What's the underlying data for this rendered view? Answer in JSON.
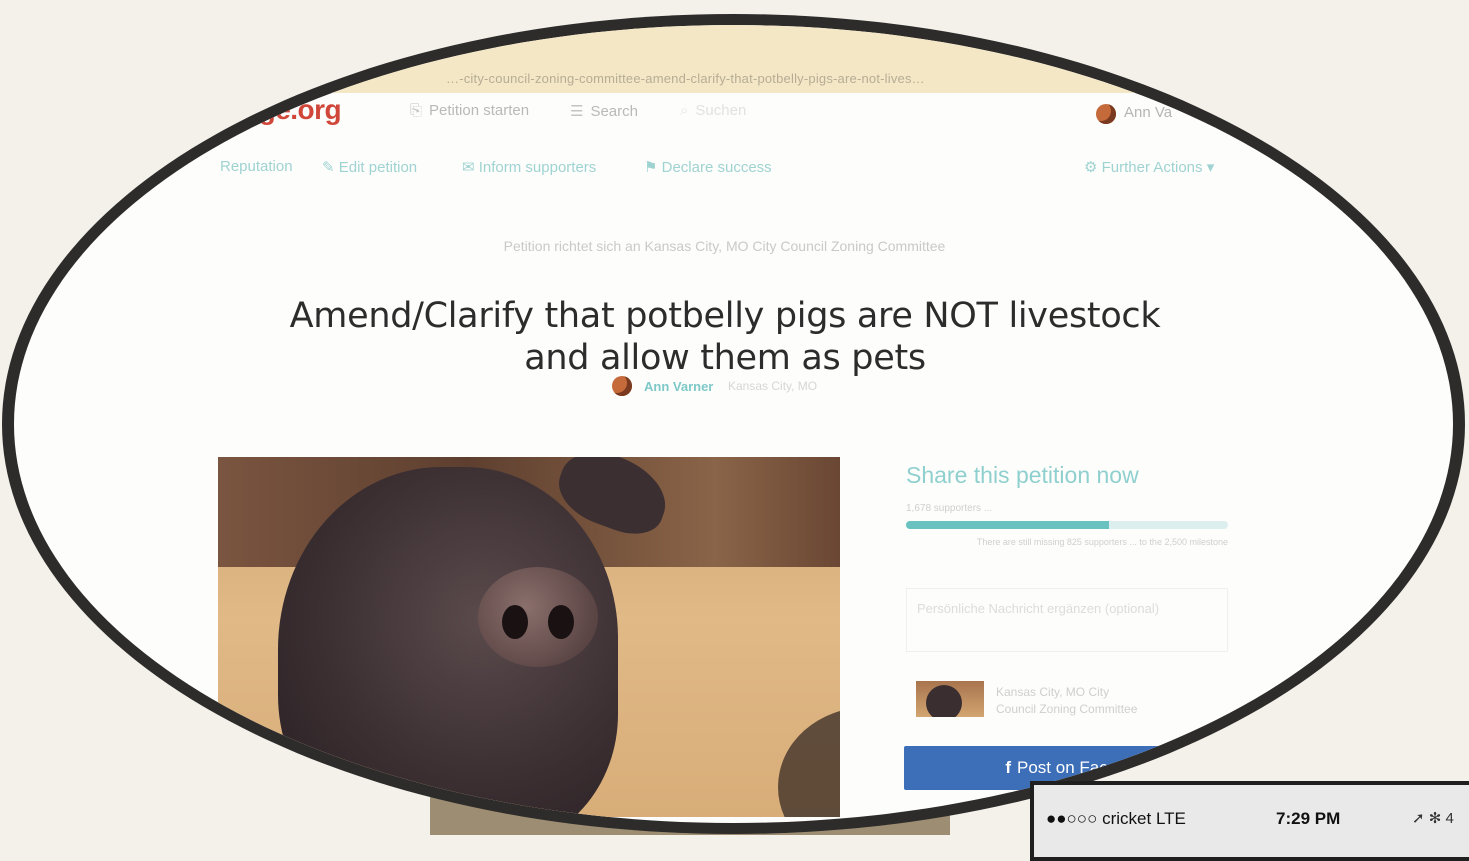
{
  "browser": {
    "url": "…-city-council-zoning-committee-amend-clarify-that-potbelly-pigs-are-not-lives…"
  },
  "header": {
    "logo": "nge.org",
    "start_petition": "Petition starten",
    "search": "Search",
    "search_placeholder": "Suchen",
    "user_name": "Ann Va"
  },
  "actions": {
    "reputation": "Reputation",
    "edit_petition": "Edit petition",
    "inform_supporters": "Inform supporters",
    "declare_success": "Declare success",
    "further_actions": "Further Actions"
  },
  "petition": {
    "target_line": "Petition richtet sich an Kansas City, MO City Council Zoning Committee",
    "title": "Amend/Clarify that potbelly pigs are NOT livestock and allow them as pets",
    "author": "Ann Varner",
    "author_location": "Kansas City, MO"
  },
  "sidebar": {
    "share_title": "Share this petition now",
    "supporters": "1,678 supporters ...",
    "progress_fraction": 0.63,
    "progress_note": "There are still missing 825 supporters ... to the 2,500 milestone",
    "message_placeholder": "Persönliche Nachricht ergänzen (optional)",
    "target_name_line1": "Kansas City, MO City",
    "target_name_line2": "Council Zoning Committee",
    "facebook_button": "Post on Faceb"
  },
  "phone_status": {
    "signal": "●●○○○",
    "carrier": "cricket",
    "network": "LTE",
    "time": "7:29 PM",
    "icons": "➚ ✻ 4"
  },
  "colors": {
    "brand": "#d0473a",
    "teal": "#69c2c0",
    "facebook": "#3c6fb7"
  }
}
